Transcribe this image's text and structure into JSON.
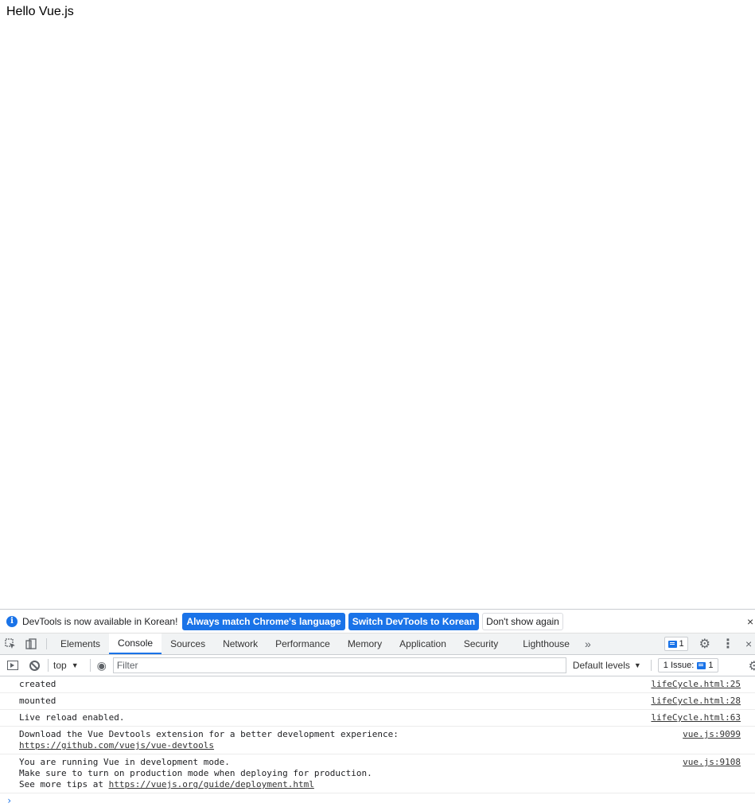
{
  "page": {
    "text": "Hello Vue.js"
  },
  "infobar": {
    "message": "DevTools is now available in Korean!",
    "btn_match": "Always match Chrome's language",
    "btn_switch": "Switch DevTools to Korean",
    "btn_dismiss": "Don't show again",
    "close": "×"
  },
  "tabs": {
    "items": [
      "Elements",
      "Console",
      "Sources",
      "Network",
      "Performance",
      "Memory",
      "Application",
      "Security",
      "Lighthouse"
    ],
    "more": "»",
    "issue_count": "1",
    "close": "×"
  },
  "toolbar": {
    "context": "top",
    "filter_placeholder": "Filter",
    "levels": "Default levels",
    "issues_label": "1 Issue:",
    "issues_count": "1"
  },
  "console": {
    "messages": [
      {
        "text": "created",
        "source": "lifeCycle.html:25"
      },
      {
        "text": "mounted",
        "source": "lifeCycle.html:28"
      },
      {
        "text": "Live reload enabled.",
        "source": "lifeCycle.html:63"
      },
      {
        "text": "Download the Vue Devtools extension for a better development experience:",
        "link": "https://github.com/vuejs/vue-devtools",
        "source": "vue.js:9099"
      },
      {
        "text": "You are running Vue in development mode.\nMake sure to turn on production mode when deploying for production.\nSee more tips at ",
        "link": "https://vuejs.org/guide/deployment.html",
        "source": "vue.js:9108"
      }
    ],
    "prompt": "›"
  },
  "colors": {
    "accent": "#1a73e8",
    "border": "#cacdd1"
  }
}
